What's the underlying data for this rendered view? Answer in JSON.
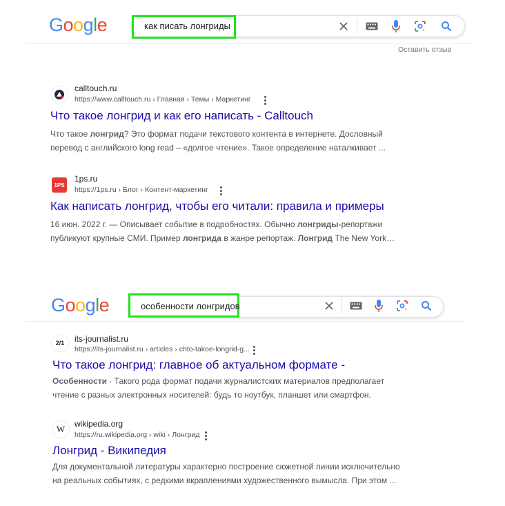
{
  "logo": {
    "letters": [
      "G",
      "o",
      "o",
      "g",
      "l",
      "e"
    ],
    "colors": [
      "#4285f4",
      "#ea4335",
      "#fbbc05",
      "#4285f4",
      "#34a853",
      "#ea4335"
    ]
  },
  "search1": {
    "query": "как писать лонгриды"
  },
  "search2": {
    "query": "особенности лонгридов"
  },
  "feedback": "Оставить отзыв",
  "highlight_color": "#21e21d",
  "results": [
    {
      "site": "calltouch.ru",
      "url": "https://www.calltouch.ru › Главная › Темы › Маркетинг",
      "title": "Что такое лонгрид и как его написать - Calltouch",
      "snippet": [
        [
          {
            "t": "Что такое "
          },
          {
            "t": "лонгрид",
            "b": true
          },
          {
            "t": "? Это формат подачи текстового контента в интернете. Дословный"
          }
        ],
        [
          {
            "t": "перевод с английского long read – «долгое чтение». Такое определение наталкивает ..."
          }
        ]
      ]
    },
    {
      "site": "1ps.ru",
      "favicon_text": "1PS",
      "url": "https://1ps.ru › Блог › Контент-маркетинг",
      "title": "Как написать лонгрид, чтобы его читали: правила и примеры",
      "snippet": [
        [
          {
            "t": "16 июн. 2022 г. — Описывает событие в подробностях. Обычно "
          },
          {
            "t": "лонгриды",
            "b": true
          },
          {
            "t": "-репортажи"
          }
        ],
        [
          {
            "t": "публикуют крупные СМИ. Пример "
          },
          {
            "t": "лонгрида",
            "b": true
          },
          {
            "t": " в жанре репортаж. "
          },
          {
            "t": "Лонгрид",
            "b": true
          },
          {
            "t": " The New York…"
          }
        ]
      ]
    },
    {
      "site": "its-journalist.ru",
      "favicon_text": "2/1",
      "url": "https://its-journalist.ru › articles › chto-takoe-longrid-g...",
      "title": "Что такое лонгрид: главное об актуальном формате -",
      "snippet": [
        [
          {
            "t": "Особенности",
            "b": true
          },
          {
            "t": " · Такого рода формат подачи журналистских материалов предполагает"
          }
        ],
        [
          {
            "t": "чтение с разных электронных носителей: будь то ноутбук, планшет или смартфон."
          }
        ]
      ]
    },
    {
      "site": "wikipedia.org",
      "favicon_text": "W",
      "url": "https://ru.wikipedia.org › wiki › Лонгрид",
      "title": "Лонгрид - Википедия",
      "snippet": [
        [
          {
            "t": "Для документальной литературы характерно построение сюжетной линии исключительно"
          }
        ],
        [
          {
            "t": "на реальных событиях, с редкими вкраплениями художественного вымысла. При этом ..."
          }
        ]
      ]
    }
  ]
}
